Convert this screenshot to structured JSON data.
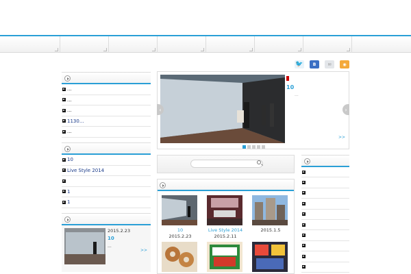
{
  "social": {
    "b_label": "B"
  },
  "left_list_1": [
    "...",
    "...",
    "...",
    "1130...",
    "..."
  ],
  "left_list_2": [
    "10",
    "Live Style 2014",
    "",
    "1",
    "1"
  ],
  "slider": {
    "title": "10",
    "dots": "...",
    "more": ">>"
  },
  "feature": {
    "date": "2015.2.23",
    "title": "10",
    "dots": "...",
    "more": ">>"
  },
  "grid": {
    "items": [
      {
        "caption": "10",
        "date": "2015.2.23"
      },
      {
        "caption": "Live Style 2014",
        "date": "2015.2.11"
      },
      {
        "caption": "",
        "date": "2015.1.5"
      }
    ]
  },
  "colors": {
    "accent": "#2a9fd6",
    "link": "#1a3b8a"
  }
}
